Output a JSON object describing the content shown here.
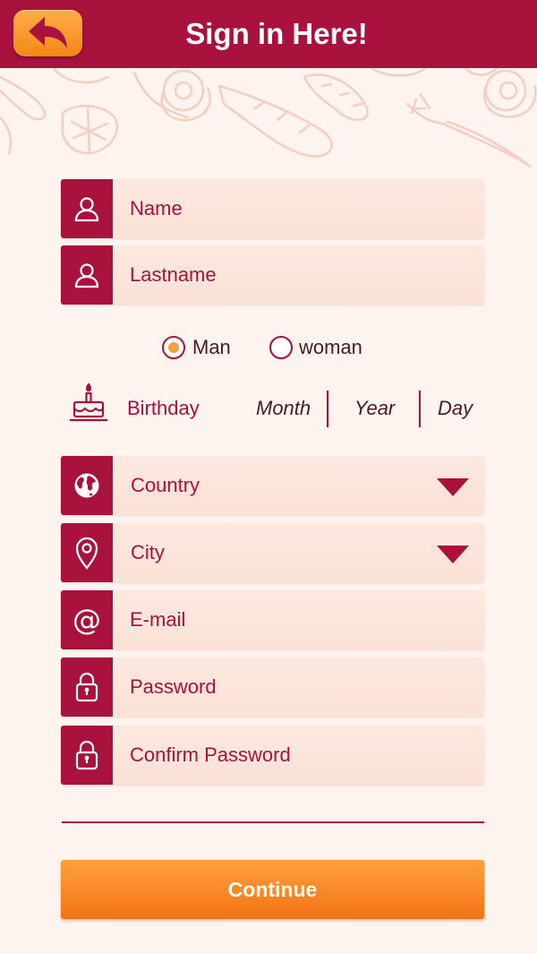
{
  "header": {
    "title": "Sign in Here!",
    "back_icon": "back-arrow-icon"
  },
  "form": {
    "name_placeholder": "Name",
    "lastname_placeholder": "Lastname",
    "gender": {
      "options": [
        "Man",
        "woman"
      ],
      "selected": "Man"
    },
    "birthday": {
      "label": "Birthday",
      "month": "Month",
      "year": "Year",
      "day": "Day"
    },
    "country_label": "Country",
    "city_label": "City",
    "email_placeholder": "E-mail",
    "password_placeholder": "Password",
    "confirm_password_placeholder": "Confirm Password"
  },
  "continue_label": "Continue",
  "colors": {
    "primary": "#a8123d",
    "accent": "#f58a1f",
    "background": "#fdf3ef",
    "field": "#fbe4da"
  }
}
